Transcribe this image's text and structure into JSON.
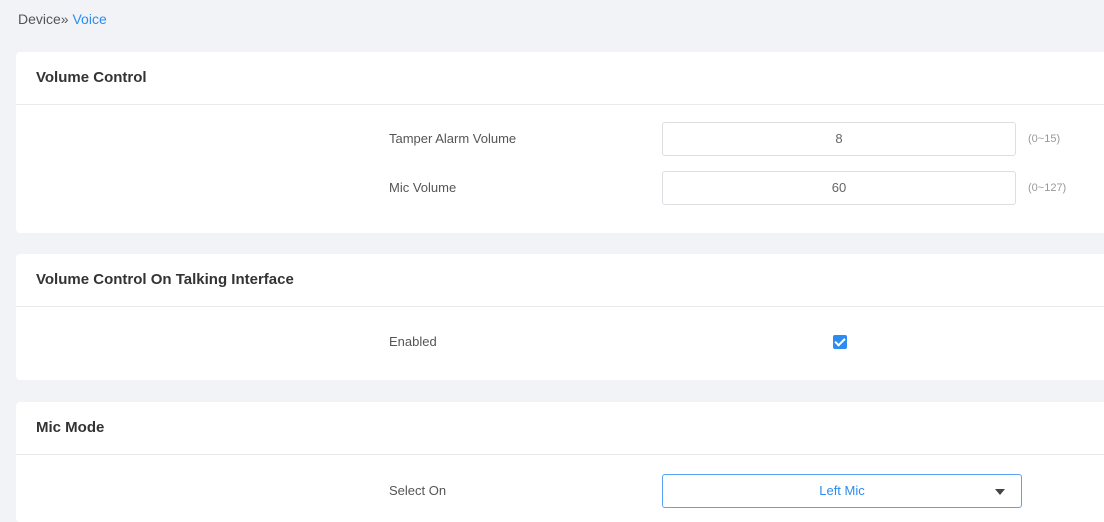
{
  "breadcrumb": {
    "parent": "Device»",
    "current": "Voice"
  },
  "volume_control": {
    "title": "Volume Control",
    "tamper_alarm": {
      "label": "Tamper Alarm Volume",
      "value": "8",
      "range": "(0~15)"
    },
    "mic_volume": {
      "label": "Mic Volume",
      "value": "60",
      "range": "(0~127)"
    }
  },
  "talking_interface": {
    "title": "Volume Control On Talking Interface",
    "enabled": {
      "label": "Enabled",
      "checked": true
    }
  },
  "mic_mode": {
    "title": "Mic Mode",
    "select_on": {
      "label": "Select On",
      "value": "Left Mic"
    }
  },
  "colors": {
    "accent": "#2d8cf0",
    "background": "#f1f3f6",
    "panel": "#ffffff"
  }
}
